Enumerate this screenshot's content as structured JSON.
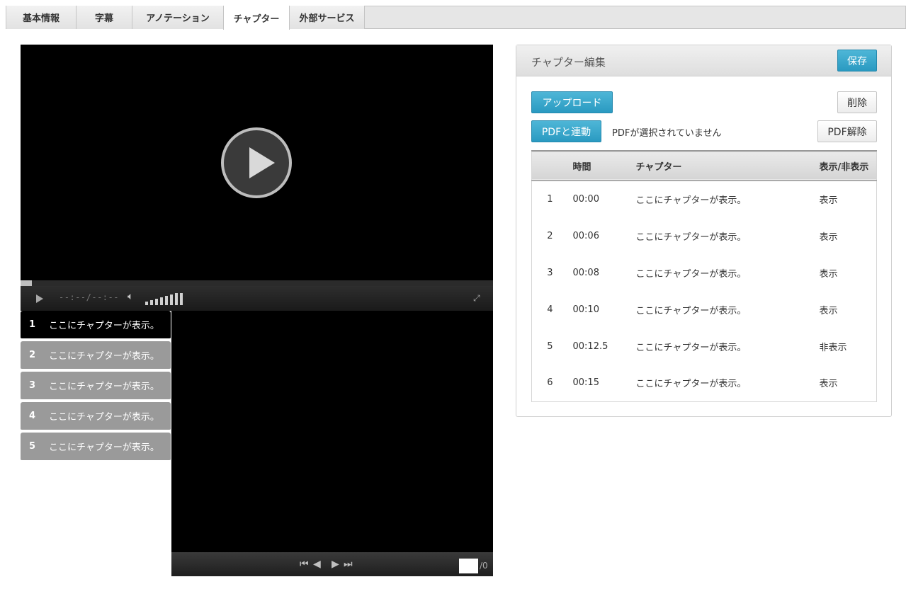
{
  "tabs": [
    {
      "label": "基本情報"
    },
    {
      "label": "字幕"
    },
    {
      "label": "アノテーション"
    },
    {
      "label": "チャプター"
    },
    {
      "label": "外部サービス"
    }
  ],
  "player": {
    "time_display": "--:--/--:--",
    "volume_icon": "speaker-icon",
    "volume_level_fraction": 1.0
  },
  "chapter_list": [
    {
      "num": "1",
      "text": "ここにチャプターが表示。"
    },
    {
      "num": "2",
      "text": "ここにチャプターが表示。"
    },
    {
      "num": "3",
      "text": "ここにチャプターが表示。"
    },
    {
      "num": "4",
      "text": "ここにチャプターが表示。"
    },
    {
      "num": "5",
      "text": "ここにチャプターが表示。"
    }
  ],
  "pdf_viewer": {
    "page_value": "",
    "total": "/0"
  },
  "editor": {
    "title": "チャプター編集",
    "save": "保存",
    "upload": "アップロード",
    "delete": "削除",
    "pdf_link": "PDFと連動",
    "pdf_status": "PDFが選択されていません",
    "pdf_unlink": "PDF解除",
    "headers": {
      "num": "",
      "time": "時間",
      "chapter": "チャプター",
      "visibility": "表示/非表示"
    },
    "rows": [
      {
        "num": "1",
        "time": "00:00",
        "chapter": "ここにチャプターが表示。",
        "visibility": "表示"
      },
      {
        "num": "2",
        "time": "00:06",
        "chapter": "ここにチャプターが表示。",
        "visibility": "表示"
      },
      {
        "num": "3",
        "time": "00:08",
        "chapter": "ここにチャプターが表示。",
        "visibility": "表示"
      },
      {
        "num": "4",
        "time": "00:10",
        "chapter": "ここにチャプターが表示。",
        "visibility": "表示"
      },
      {
        "num": "5",
        "time": "00:12.5",
        "chapter": "ここにチャプターが表示。",
        "visibility": "非表示"
      },
      {
        "num": "6",
        "time": "00:15",
        "chapter": "ここにチャプターが表示。",
        "visibility": "表示"
      }
    ]
  }
}
